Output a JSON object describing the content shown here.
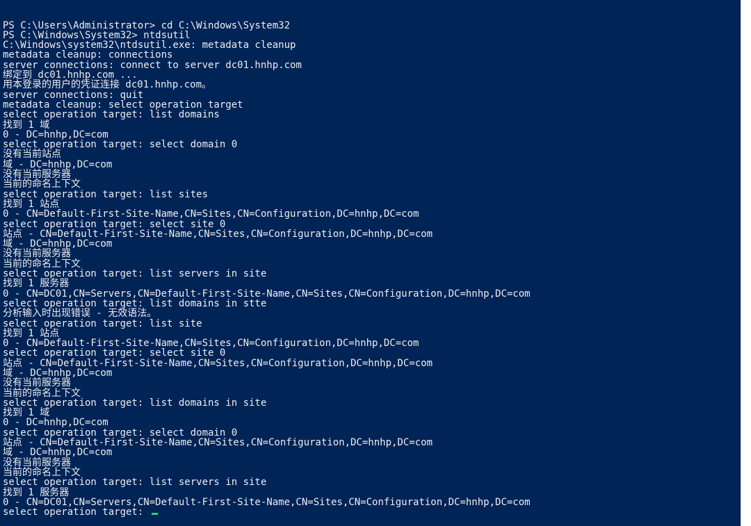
{
  "console": {
    "lines": [
      "PS C:\\Users\\Administrator> cd C:\\Windows\\System32",
      "PS C:\\Windows\\System32> ntdsutil",
      "C:\\Windows\\system32\\ntdsutil.exe: metadata cleanup",
      "metadata cleanup: connections",
      "server connections: connect to server dc01.hnhp.com",
      "绑定到 dc01.hnhp.com ...",
      "用本登录的用户的凭证连接 dc01.hnhp.com。",
      "server connections: quit",
      "metadata cleanup: select operation target",
      "select operation target: list domains",
      "找到 1 域",
      "0 - DC=hnhp,DC=com",
      "select operation target: select domain 0",
      "没有当前站点",
      "域 - DC=hnhp,DC=com",
      "没有当前服务器",
      "当前的命名上下文",
      "select operation target: list sites",
      "找到 1 站点",
      "0 - CN=Default-First-Site-Name,CN=Sites,CN=Configuration,DC=hnhp,DC=com",
      "select operation target: select site 0",
      "站点 - CN=Default-First-Site-Name,CN=Sites,CN=Configuration,DC=hnhp,DC=com",
      "域 - DC=hnhp,DC=com",
      "没有当前服务器",
      "当前的命名上下文",
      "select operation target: list servers in site",
      "找到 1 服务器",
      "0 - CN=DC01,CN=Servers,CN=Default-First-Site-Name,CN=Sites,CN=Configuration,DC=hnhp,DC=com",
      "select operation target: list domains in stte",
      "分析输入时出现错误 - 无效语法。",
      "select operation target: list site",
      "找到 1 站点",
      "0 - CN=Default-First-Site-Name,CN=Sites,CN=Configuration,DC=hnhp,DC=com",
      "select operation target: select site 0",
      "站点 - CN=Default-First-Site-Name,CN=Sites,CN=Configuration,DC=hnhp,DC=com",
      "域 - DC=hnhp,DC=com",
      "没有当前服务器",
      "当前的命名上下文",
      "select operation target: list domains in site",
      "找到 1 域",
      "0 - DC=hnhp,DC=com",
      "select operation target: select domain 0",
      "站点 - CN=Default-First-Site-Name,CN=Sites,CN=Configuration,DC=hnhp,DC=com",
      "域 - DC=hnhp,DC=com",
      "没有当前服务器",
      "当前的命名上下文",
      "select operation target: list servers in site",
      "找到 1 服务器",
      "0 - CN=DC01,CN=Servers,CN=Default-First-Site-Name,CN=Sites,CN=Configuration,DC=hnhp,DC=com"
    ],
    "prompt": "select operation target: "
  },
  "colors": {
    "background": "#012456",
    "text": "#eeedf0",
    "cursor": "#13e26f"
  }
}
